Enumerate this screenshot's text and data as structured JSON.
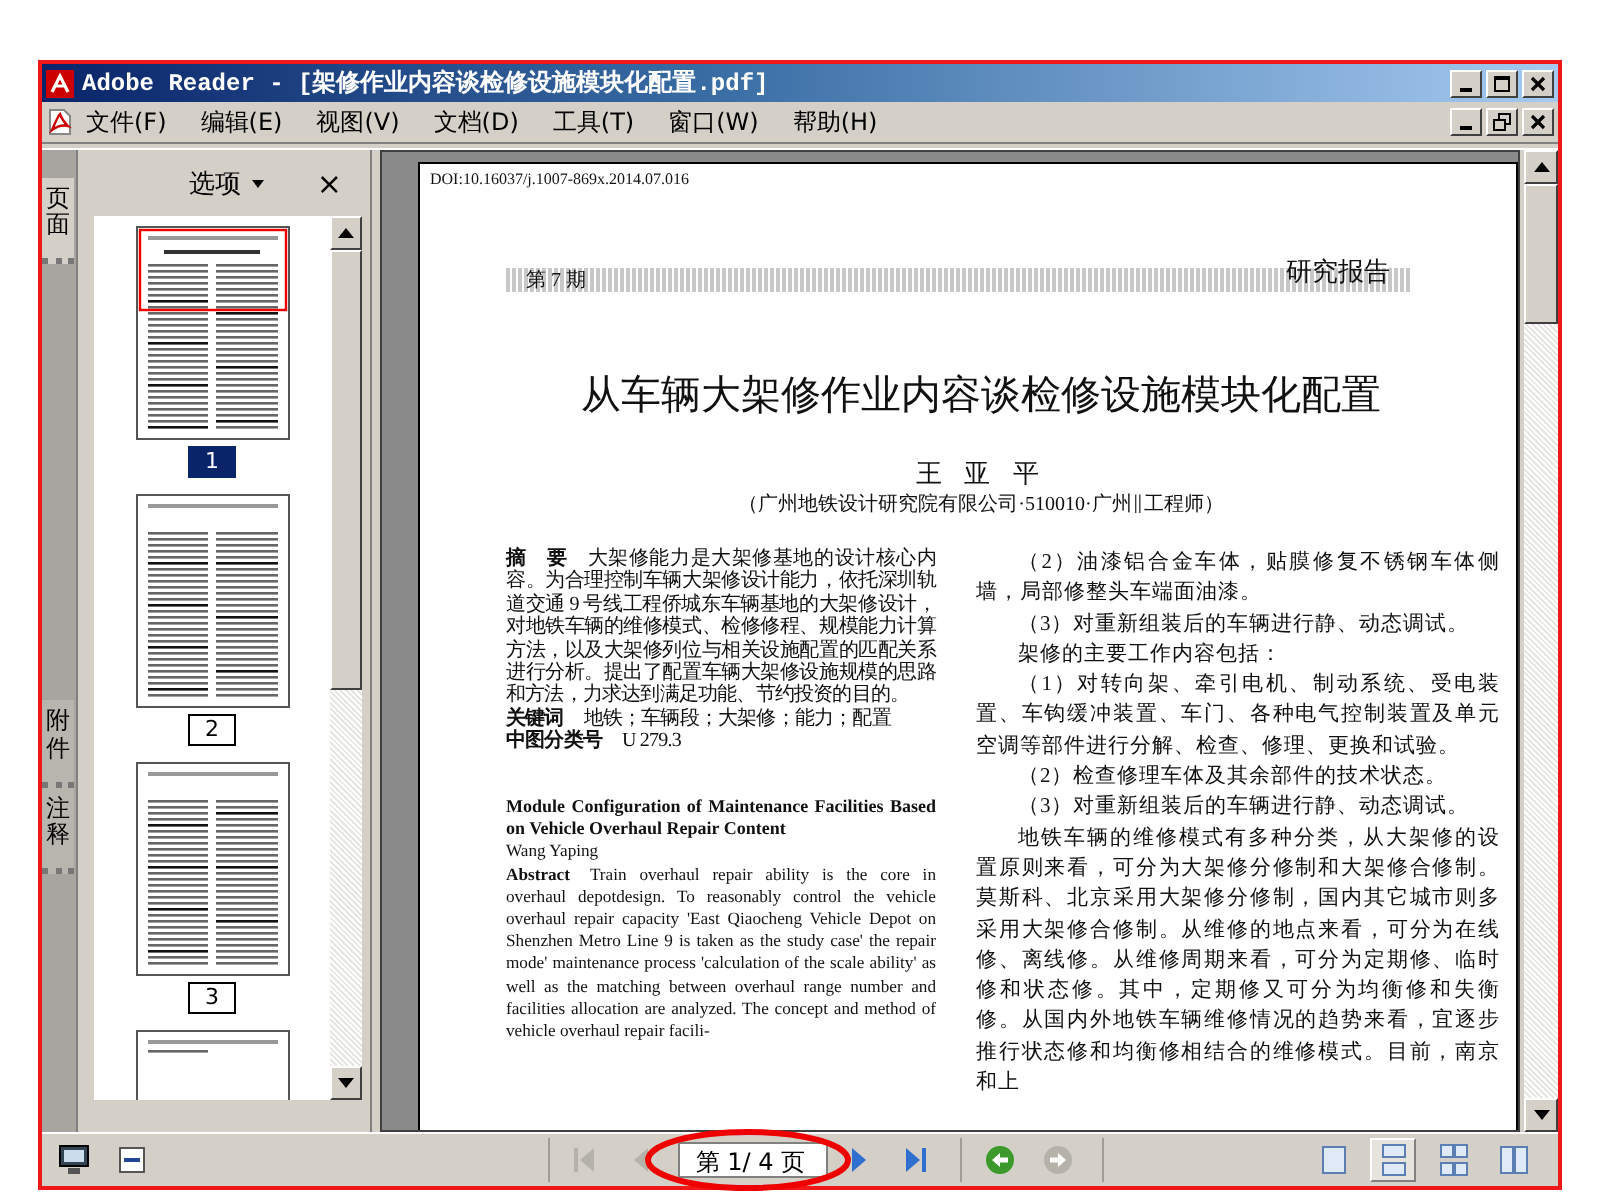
{
  "window": {
    "title": "Adobe Reader - [架修作业内容谈检修设施模块化配置.pdf]"
  },
  "menu": [
    "文件(F)",
    "编辑(E)",
    "视图(V)",
    "文档(D)",
    "工具(T)",
    "窗口(W)",
    "帮助(H)"
  ],
  "side_tabs": [
    {
      "label": "页面",
      "selected": true
    },
    {
      "label": "附件",
      "selected": false
    },
    {
      "label": "注释",
      "selected": false
    }
  ],
  "thumbnail_panel": {
    "options": "选项",
    "close": "×",
    "thumbnails": [
      {
        "label": "1",
        "selected": true
      },
      {
        "label": "2",
        "selected": false
      },
      {
        "label": "3",
        "selected": false
      }
    ]
  },
  "document": {
    "doi": "DOI:10.16037/j.1007-869x.2014.07.016",
    "issue": "第 7 期",
    "section": "研究报告",
    "title": "从车辆大架修作业内容谈检修设施模块化配置",
    "author": "王 亚 平",
    "affiliation": "（广州地铁设计研究院有限公司·510010·广州∥工程师）",
    "left_column": [
      {
        "kind": "labeled",
        "label": "摘　要",
        "text": "大架修能力是大架修基地的设计核心内容。为合理控制车辆大架修设计能力，依托深圳轨道交通 9 号线工程侨城东车辆基地的大架修设计，对地铁车辆的维修模式、检修修程、规模能力计算方法，以及大架修列位与相关设施配置的匹配关系进行分析。提出了配置车辆大架修设施规模的思路和方法，力求达到满足功能、节约投资的目的。"
      },
      {
        "kind": "labeled",
        "label": "关键词",
        "text": "地铁；车辆段；大架修；能力；配置"
      },
      {
        "kind": "labeled",
        "label": "中图分类号",
        "text": "U 279.3"
      },
      {
        "kind": "heading",
        "text": "Module Configuration of Maintenance Facilities Based on Vehicle Overhaul Repair Content"
      },
      {
        "kind": "byline",
        "text": "Wang Yaping"
      },
      {
        "kind": "abstract",
        "label": "Abstract",
        "text": "Train overhaul repair ability is the core in overhaul depotdesign. To reasonably control the vehicle overhaul repair capacity 'East Qiaocheng Vehicle Depot on Shenzhen Metro Line 9 is taken as the study case' the repair mode' maintenance process 'calculation of the scale ability' as well as the matching between overhaul range number and facilities allocation are analyzed. The concept and method of vehicle overhaul repair facili-"
      }
    ],
    "right_column": [
      "（2）油漆铝合金车体，贴膜修复不锈钢车体侧墙，局部修整头车端面油漆。",
      "（3）对重新组装后的车辆进行静、动态调试。",
      "架修的主要工作内容包括：",
      "（1）对转向架、牵引电机、制动系统、受电装置、车钩缓冲装置、车门、各种电气控制装置及单元空调等部件进行分解、检查、修理、更换和试验。",
      "（2）检查修理车体及其余部件的技术状态。",
      "（3）对重新组装后的车辆进行静、动态调试。",
      "地铁车辆的维修模式有多种分类，从大架修的设置原则来看，可分为大架修分修制和大架修合修制。莫斯科、北京采用大架修分修制，国内其它城市则多采用大架修合修制。从维修的地点来看，可分为在线修、离线修。从维修周期来看，可分为定期修、临时修和状态修。其中，定期修又可分为均衡修和失衡修。从国内外地铁车辆维修情况的趋势来看，宜逐步推行状态修和均衡修相结合的维修模式。目前，南京和上"
    ]
  },
  "page_nav": [
    {
      "kind": "first",
      "disabled": true
    },
    {
      "kind": "prev",
      "disabled": true
    },
    {
      "kind": "next",
      "disabled": false
    },
    {
      "kind": "last",
      "disabled": false
    }
  ],
  "page_field": {
    "value": "第 1/ 4 页"
  },
  "history": [
    {
      "kind": "back",
      "disabled": false
    },
    {
      "kind": "forward",
      "disabled": true
    }
  ],
  "view_modes": [
    {
      "kind": "single",
      "selected": false
    },
    {
      "kind": "continuous",
      "selected": true
    },
    {
      "kind": "facing",
      "selected": false
    },
    {
      "kind": "continuous-facing",
      "selected": false
    }
  ]
}
